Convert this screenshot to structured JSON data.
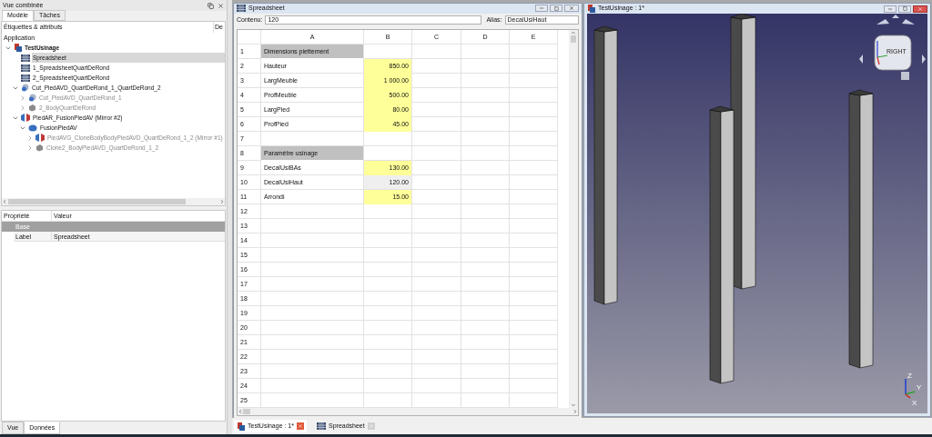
{
  "combo_view": {
    "title": "Vue combinée",
    "tabs": [
      {
        "label": "Modèle",
        "selected": true
      },
      {
        "label": "Tâches",
        "selected": false
      }
    ],
    "tree_header": [
      "Étiquettes & attributs",
      "De"
    ],
    "root_label": "Application",
    "tree": [
      {
        "label": "TestUsinage",
        "kind": "document",
        "bold": true,
        "expanded": true,
        "selected": false,
        "disabled": false,
        "children": [
          {
            "label": "Spreadsheet",
            "kind": "sheet",
            "selected": true,
            "disabled": false
          },
          {
            "label": "1_SpreadsheetQuartDeRond",
            "kind": "sheet",
            "selected": false,
            "disabled": false
          },
          {
            "label": "2_SpreadsheetQuartDeRond",
            "kind": "sheet",
            "selected": false,
            "disabled": false
          },
          {
            "label": "Cut_PiedAVD_QuartDeRond_1_QuartDeRond_2",
            "kind": "cut",
            "expanded": true,
            "selected": false,
            "disabled": false,
            "children": [
              {
                "label": "Cut_PiedAVD_QuartDeRond_1",
                "kind": "cut",
                "expanded": false,
                "selected": false,
                "disabled": true
              },
              {
                "label": "2_BodyQuartDeRond",
                "kind": "body",
                "expanded": false,
                "selected": false,
                "disabled": true
              }
            ]
          },
          {
            "label": "PiedAR_FusionPiedAV (Mirror #2)",
            "kind": "mirror",
            "expanded": true,
            "selected": false,
            "disabled": false,
            "children": [
              {
                "label": "FusionPiedAV",
                "kind": "fusion",
                "expanded": true,
                "selected": false,
                "disabled": false,
                "children": [
                  {
                    "label": "PiedAVG_CloneBodyBodyPiedAVD_QuartDeRond_1_2 (Mirror #1)",
                    "kind": "mirror",
                    "expanded": false,
                    "selected": false,
                    "disabled": true
                  },
                  {
                    "label": "Clone2_BodyPiedAVD_QuartDeRond_1_2",
                    "kind": "body",
                    "expanded": false,
                    "selected": false,
                    "disabled": true
                  }
                ]
              }
            ]
          }
        ]
      }
    ],
    "properties": {
      "columns": [
        "Propriété",
        "Valeur"
      ],
      "rows": [
        {
          "kind": "group",
          "label": "Base"
        },
        {
          "kind": "property",
          "name": "Label",
          "value": "Spreadsheet"
        }
      ]
    },
    "bottom_tabs": [
      {
        "label": "Vue",
        "selected": false
      },
      {
        "label": "Données",
        "selected": true
      }
    ]
  },
  "spreadsheet": {
    "title": "Spreadsheet",
    "content_label": "Contenu:",
    "content_value": "120",
    "alias_label": "Alias:",
    "alias_value": "DecalUsiHaut",
    "columns": [
      "A",
      "B",
      "C",
      "D",
      "E"
    ],
    "rows": [
      {
        "number": "1",
        "a": {
          "text": "Dimensions piettement",
          "kind": "header"
        }
      },
      {
        "number": "2",
        "a": {
          "text": "Hauteur",
          "kind": "label"
        },
        "b": {
          "text": "850.00",
          "color": "#ffff99",
          "selected": false
        }
      },
      {
        "number": "3",
        "a": {
          "text": "LargMeuble",
          "kind": "label"
        },
        "b": {
          "text": "1 000.00",
          "color": "#ffff99",
          "selected": false
        }
      },
      {
        "number": "4",
        "a": {
          "text": "ProfMeuble",
          "kind": "label"
        },
        "b": {
          "text": "500.00",
          "color": "#ffff99",
          "selected": false
        }
      },
      {
        "number": "5",
        "a": {
          "text": "LargPied",
          "kind": "label"
        },
        "b": {
          "text": "80.00",
          "color": "#ffff99",
          "selected": false
        }
      },
      {
        "number": "6",
        "a": {
          "text": "ProfPied",
          "kind": "label"
        },
        "b": {
          "text": "45.00",
          "color": "#ffff99",
          "selected": false
        }
      },
      {
        "number": "7"
      },
      {
        "number": "8",
        "a": {
          "text": "Paramètre usinage",
          "kind": "header"
        }
      },
      {
        "number": "9",
        "a": {
          "text": "DecalUsiBAs",
          "kind": "label"
        },
        "b": {
          "text": "130.00",
          "color": "#ffff99",
          "selected": false
        }
      },
      {
        "number": "10",
        "a": {
          "text": "DecalUsiHaut",
          "kind": "label"
        },
        "b": {
          "text": "120.00",
          "selected": true
        }
      },
      {
        "number": "11",
        "a": {
          "text": "Arrondi",
          "kind": "label"
        },
        "b": {
          "text": "15.00",
          "color": "#ffff99",
          "selected": false
        }
      },
      {
        "number": "12"
      },
      {
        "number": "13"
      },
      {
        "number": "14"
      },
      {
        "number": "15"
      },
      {
        "number": "16"
      },
      {
        "number": "17"
      },
      {
        "number": "18"
      },
      {
        "number": "19"
      },
      {
        "number": "20"
      },
      {
        "number": "21"
      },
      {
        "number": "22"
      },
      {
        "number": "23"
      },
      {
        "number": "24"
      },
      {
        "number": "25"
      }
    ]
  },
  "viewer": {
    "title": "TestUsinage : 1*",
    "cube_face": "RIGHT",
    "axes": [
      "Z",
      "Y",
      "X"
    ]
  },
  "doc_tabs": [
    {
      "label": "TestUsinage : 1*",
      "kind": "document",
      "selected": true
    },
    {
      "label": "Spreadsheet",
      "kind": "sheet",
      "selected": false
    }
  ]
}
